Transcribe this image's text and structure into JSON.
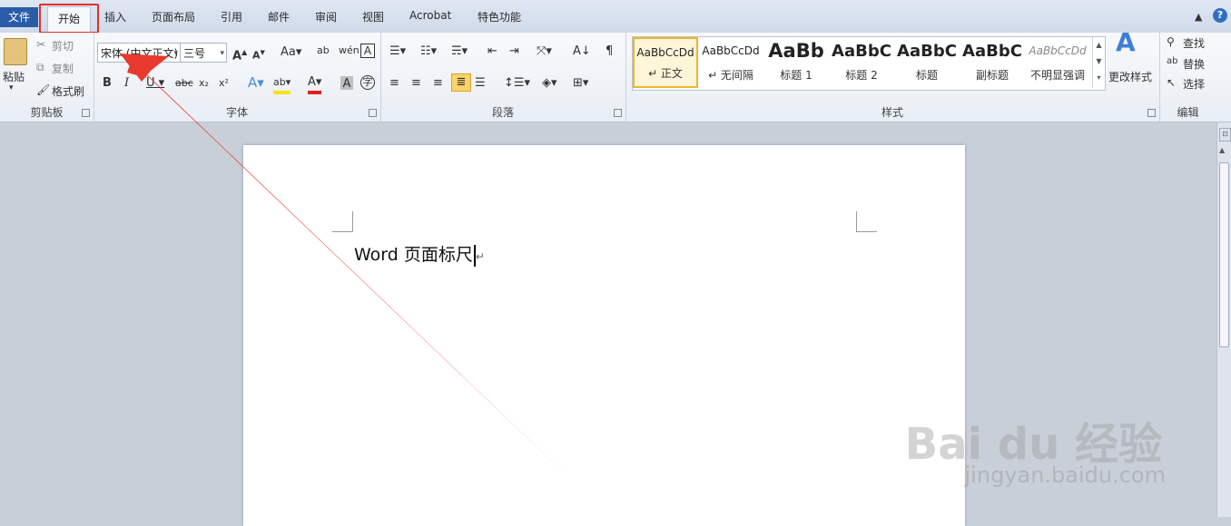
{
  "tabs": {
    "file": "文件",
    "home": "开始",
    "items": [
      "插入",
      "页面布局",
      "引用",
      "邮件",
      "审阅",
      "视图",
      "Acrobat",
      "特色功能"
    ]
  },
  "clipboard": {
    "paste": "粘贴",
    "cut": "剪切",
    "copy": "复制",
    "format_painter": "格式刷",
    "label": "剪贴板"
  },
  "font": {
    "name": "宋体 (中文正文)",
    "size": "三号",
    "label": "字体"
  },
  "paragraph": {
    "label": "段落"
  },
  "styles": {
    "label": "样式",
    "change": "更改样式",
    "items": [
      {
        "sample": "AaBbCcDd",
        "name": "↵ 正文",
        "selected": true
      },
      {
        "sample": "AaBbCcDd",
        "name": "↵ 无间隔"
      },
      {
        "sample": "AaBb",
        "name": "标题 1"
      },
      {
        "sample": "AaBbC",
        "name": "标题 2"
      },
      {
        "sample": "AaBbC",
        "name": "标题"
      },
      {
        "sample": "AaBbC",
        "name": "副标题"
      },
      {
        "sample": "AaBbCcDd",
        "name": "不明显强调"
      }
    ]
  },
  "editing": {
    "find": "查找",
    "replace": "替换",
    "select": "选择",
    "label": "编辑"
  },
  "document": {
    "text": "Word 页面标尺"
  },
  "watermark": {
    "brand": "Bai du 经验",
    "url": "jingyan.baidu.com"
  },
  "colors": {
    "arrow": "#e83a2f",
    "highlight_box": "#e4302b",
    "file_tab": "#2a5ca8"
  }
}
